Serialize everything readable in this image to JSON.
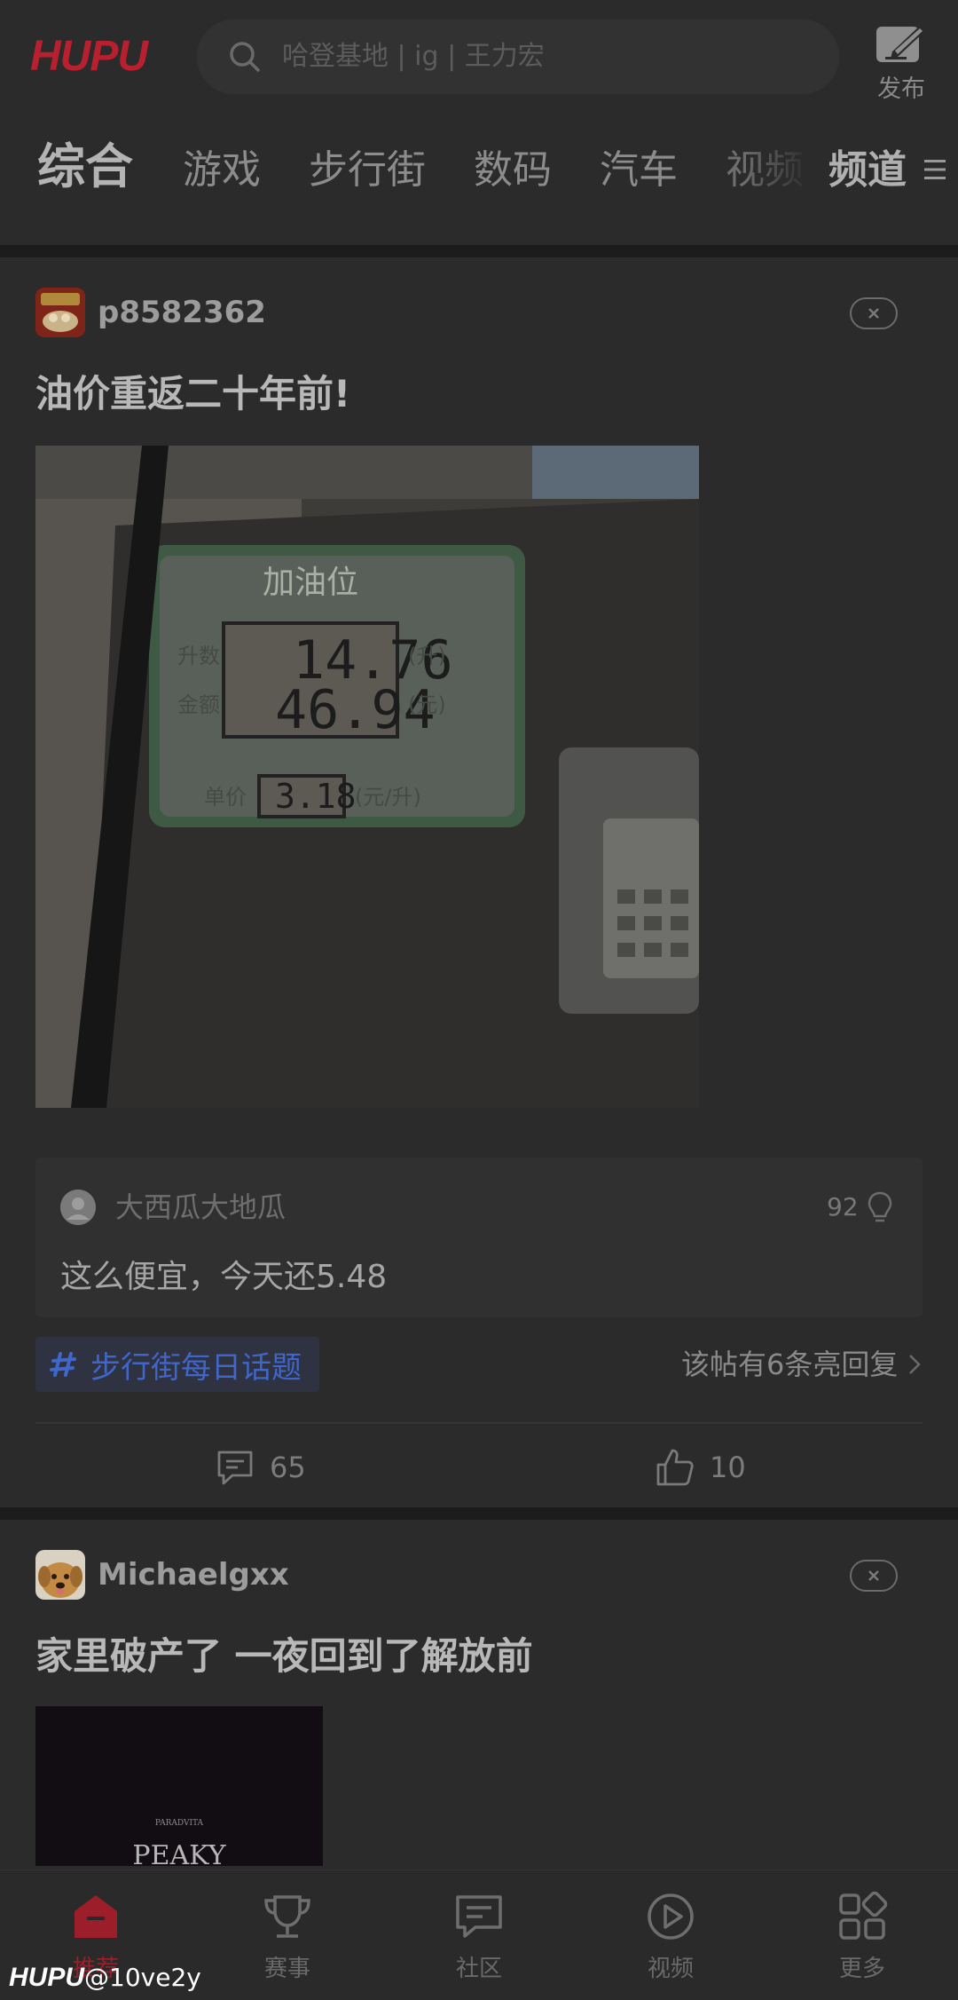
{
  "header": {
    "logo": "HUPU",
    "search_placeholder": "哈登基地 | ig | 王力宏",
    "publish_label": "发布"
  },
  "tabs": [
    {
      "label": "综合",
      "active": true
    },
    {
      "label": "游戏"
    },
    {
      "label": "步行街"
    },
    {
      "label": "数码"
    },
    {
      "label": "汽车"
    },
    {
      "label": "视频"
    }
  ],
  "channel_label": "频道",
  "posts": [
    {
      "username": "p8582362",
      "title": "油价重返二十年前!",
      "image": {
        "panel_title": "加油位",
        "row_labels": [
          "升数",
          "金额",
          "单价"
        ],
        "volume": "14.76",
        "amount": "46.94",
        "unit_price": "3.18",
        "unit_volume": "(升)",
        "unit_amount": "(元)",
        "unit_price_unit": "(元/升)"
      },
      "top_comment": {
        "author": "大西瓜大地瓜",
        "likes": "92",
        "text": "这么便宜，今天还5.48"
      },
      "topic": "步行街每日话题",
      "replies_note": "该帖有6条亮回复",
      "comments_count": "65",
      "likes_count": "10"
    },
    {
      "username": "Michaelgxx",
      "title": "家里破产了 一夜回到了解放前",
      "image": {
        "small_text": "PARADVITA",
        "big_text": "PEAKY"
      }
    }
  ],
  "bottom_nav": [
    {
      "label": "推荐",
      "icon": "home-icon",
      "active": true
    },
    {
      "label": "赛事",
      "icon": "trophy-icon"
    },
    {
      "label": "社区",
      "icon": "chat-icon"
    },
    {
      "label": "视频",
      "icon": "play-icon"
    },
    {
      "label": "更多",
      "icon": "grid-icon"
    }
  ],
  "watermark": {
    "brand": "HUPU",
    "handle": "@10ve2y"
  },
  "colors": {
    "brand_red": "#b8202f",
    "topic_blue": "#3f66c8",
    "background": "#2b2b2b"
  }
}
